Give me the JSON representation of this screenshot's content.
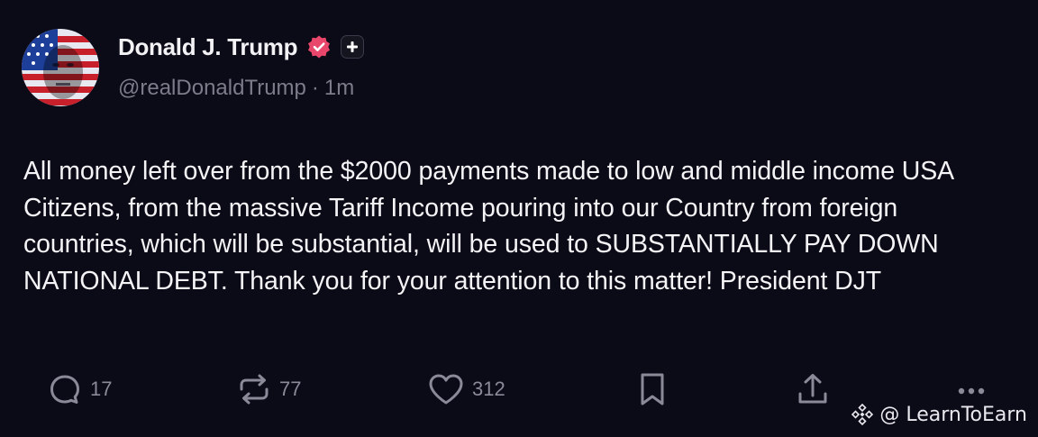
{
  "author": {
    "display_name": "Donald J. Trump",
    "handle": "@realDonaldTrump",
    "separator": "·",
    "time_ago": "1m"
  },
  "post": {
    "text": "All money left over from the $2000 payments made to low and middle income USA Citizens, from the massive Tariff Income pouring into our Country from foreign countries, which will be substantial, will be used to SUBSTANTIALLY PAY DOWN NATIONAL DEBT. Thank you for your attention to this matter! President DJT"
  },
  "actions": {
    "replies": "17",
    "reposts": "77",
    "likes": "312"
  },
  "watermark": {
    "text": "@ LearnToEarn"
  },
  "colors": {
    "background": "#0b0a17",
    "text": "#f4f4f6",
    "muted": "#7c7c8a",
    "verified": "#e8466a"
  },
  "icons": [
    "verified-badge-icon",
    "plus-icon",
    "reply-icon",
    "repost-icon",
    "like-icon",
    "bookmark-icon",
    "share-icon",
    "more-icon",
    "binance-logo-icon"
  ]
}
